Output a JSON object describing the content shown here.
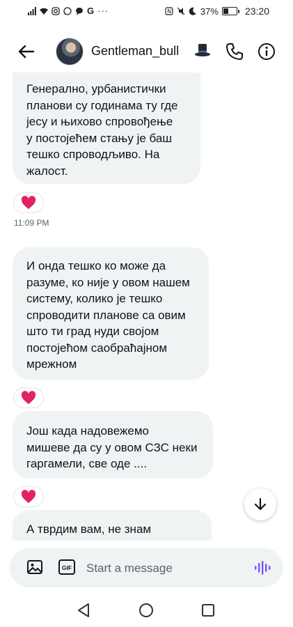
{
  "status_bar": {
    "left_icons": [
      "signal-icon",
      "wifi-icon",
      "instagram-icon",
      "whatsapp-icon",
      "chat-icon",
      "google-icon"
    ],
    "more": "···",
    "right_icons": [
      "nfc-icon",
      "mute-icon",
      "moon-icon"
    ],
    "battery": "37%",
    "time": "23:20"
  },
  "header": {
    "contact_name": "Gentleman_bull",
    "emoji": "top-hat-icon"
  },
  "messages": [
    {
      "text": "Генерално, урбанистички\nпланови су  годинама ту где\nјесу и њихово спровођење\nу постојећем стању је баш\nтешко спроводљиво. На\nжалост.",
      "reaction": "heart"
    },
    {
      "text": "И онда тешко ко може да\nразуме, ко није у овом нашем\nсистему, колико је тешко\nспроводити планове са овим\nшто ти град нуди својом\nпостојећом саобраћајном\nмрежном",
      "reaction": "heart"
    },
    {
      "text": "Још када надовежемо\nмишеве да су у овом СЗС неки\nгаргамели, све оде ....",
      "reaction": "heart"
    },
    {
      "text": "А тврдим вам, не знам",
      "reaction": ""
    }
  ],
  "timestamp": "11:09 PM",
  "composer": {
    "placeholder": "Start a message",
    "gif_label": "GIF"
  },
  "colors": {
    "bubble": "#eff3f4",
    "heart": "#e0245e",
    "voice": "#7856ff",
    "secondary_text": "#536471"
  }
}
